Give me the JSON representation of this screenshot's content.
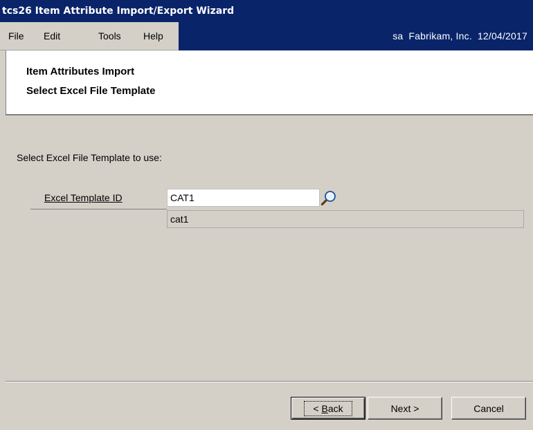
{
  "window": {
    "title": "tcs26 Item Attribute Import/Export Wizard"
  },
  "menu": {
    "items": [
      "File",
      "Edit",
      "Tools",
      "Help"
    ],
    "status": {
      "user": "sa",
      "company": "Fabrikam, Inc.",
      "date": "12/04/2017"
    }
  },
  "header": {
    "line1": "Item Attributes Import",
    "line2": "Select Excel File Template"
  },
  "form": {
    "prompt": "Select Excel File Template to use:",
    "field_label": "Excel Template ID",
    "field_value": "CAT1",
    "description_value": "cat1",
    "lookup_icon": "magnifier-icon"
  },
  "buttons": {
    "back_prefix": "< ",
    "back_accel": "B",
    "back_rest": "ack",
    "next": "Next >",
    "cancel": "Cancel"
  },
  "colors": {
    "titlebar": "#0a246a",
    "window_bg": "#d4d0c8"
  }
}
